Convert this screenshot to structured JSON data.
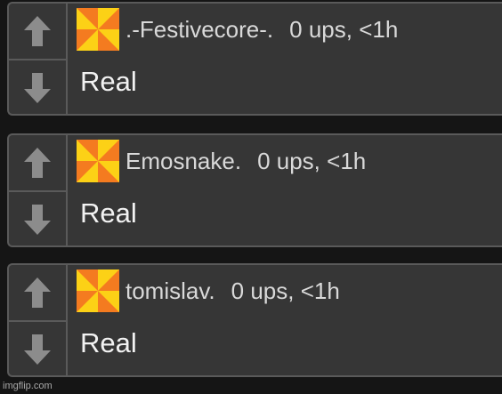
{
  "comments": [
    {
      "username": ".-Festivecore-.",
      "meta": "0 ups, <1h",
      "text": "Real",
      "upvote_icon": "arrow-up-icon",
      "downvote_icon": "arrow-down-icon",
      "avatar_icon": "pinwheel-avatar"
    },
    {
      "username": "Emosnake.",
      "meta": "0 ups, <1h",
      "text": "Real",
      "upvote_icon": "arrow-up-icon",
      "downvote_icon": "arrow-down-icon",
      "avatar_icon": "pinwheel-avatar"
    },
    {
      "username": "tomislav.",
      "meta": "0 ups, <1h",
      "text": "Real",
      "upvote_icon": "arrow-up-icon",
      "downvote_icon": "arrow-down-icon",
      "avatar_icon": "pinwheel-avatar"
    }
  ],
  "colors": {
    "page_background": "#151515",
    "card_background": "#363636",
    "card_border": "#5a5a5a",
    "text": "#d9d9d9",
    "arrow": "#8c8c8c",
    "avatar_orange": "#f47b20",
    "avatar_yellow": "#fcd116"
  },
  "watermark": "imgflip.com"
}
